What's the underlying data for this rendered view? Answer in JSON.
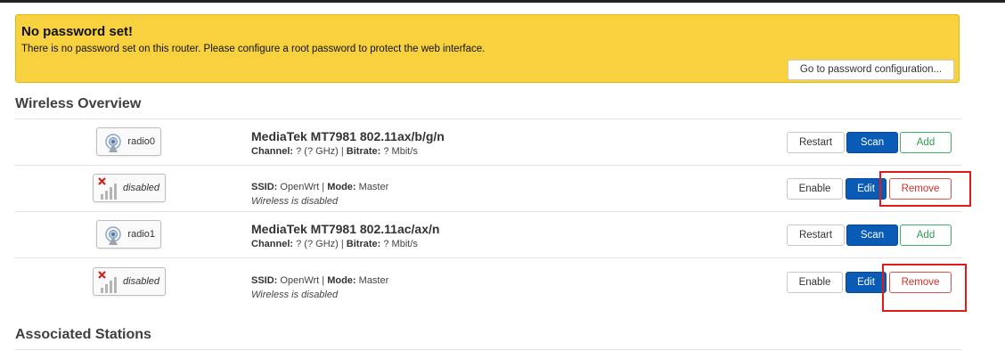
{
  "alert": {
    "title": "No password set!",
    "message": "There is no password set on this router. Please configure a root password to protect the web interface.",
    "button_label": "Go to password configuration..."
  },
  "wireless": {
    "title": "Wireless Overview",
    "rows": [
      {
        "badge_label": "radio0",
        "badge_icon": "wifi-radio-icon",
        "title": "MediaTek MT7981 802.11ax/b/g/n",
        "info": {
          "channel_label": "Channel:",
          "channel_value": "? (? GHz)",
          "sep": "|",
          "bitrate_label": "Bitrate:",
          "bitrate_value": "? Mbit/s"
        },
        "buttons": [
          "Restart",
          "Scan",
          "Add"
        ]
      },
      {
        "badge_label": "disabled",
        "badge_icon": "signal-disabled-icon",
        "info": {
          "ssid_label": "SSID:",
          "ssid_value": "OpenWrt",
          "sep": "|",
          "mode_label": "Mode:",
          "mode_value": "Master"
        },
        "status": "Wireless is disabled",
        "buttons": [
          "Enable",
          "Edit",
          "Remove"
        ]
      },
      {
        "badge_label": "radio1",
        "badge_icon": "wifi-radio-icon",
        "title": "MediaTek MT7981 802.11ac/ax/n",
        "info": {
          "channel_label": "Channel:",
          "channel_value": "? (? GHz)",
          "sep": "|",
          "bitrate_label": "Bitrate:",
          "bitrate_value": "? Mbit/s"
        },
        "buttons": [
          "Restart",
          "Scan",
          "Add"
        ]
      },
      {
        "badge_label": "disabled",
        "badge_icon": "signal-disabled-icon",
        "info": {
          "ssid_label": "SSID:",
          "ssid_value": "OpenWrt",
          "sep": "|",
          "mode_label": "Mode:",
          "mode_value": "Master"
        },
        "status": "Wireless is disabled",
        "buttons": [
          "Enable",
          "Edit",
          "Remove"
        ]
      }
    ]
  },
  "stations": {
    "title": "Associated Stations"
  },
  "colors": {
    "alert_bg": "#f8d13e",
    "primary": "#0a5bb5",
    "add": "#3cae5f",
    "remove": "#d9534f",
    "highlight": "#e01b1b"
  }
}
